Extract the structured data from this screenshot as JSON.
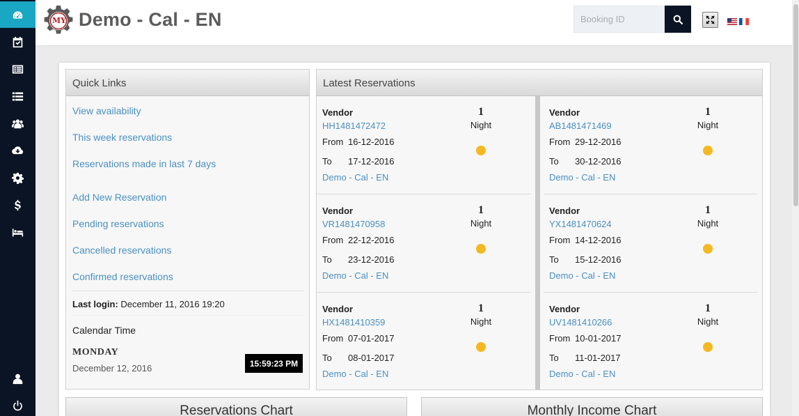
{
  "header": {
    "app_title": "Demo - Cal - EN",
    "logo_text": "MY",
    "search_placeholder": "Booking ID"
  },
  "sidebar": {
    "items": [
      {
        "icon": "dashboard-icon",
        "active": true
      },
      {
        "icon": "calendar-check-icon"
      },
      {
        "icon": "list-alt-icon"
      },
      {
        "icon": "list-icon"
      },
      {
        "icon": "users-icon"
      },
      {
        "icon": "cloud-download-icon"
      },
      {
        "icon": "gear-icon"
      },
      {
        "icon": "dollar-icon"
      },
      {
        "icon": "bed-icon"
      },
      {
        "icon": "user-icon"
      },
      {
        "icon": "power-icon"
      }
    ]
  },
  "colors": {
    "sidebar_bg": "#0b1424",
    "sidebar_active": "#1aa7c4",
    "link": "#4a90c2",
    "status_dot": "#f5b920"
  },
  "quick_links": {
    "title": "Quick Links",
    "links": [
      "View availability",
      "This week reservations",
      "Reservations made in last 7 days",
      "Add New Reservation",
      "Pending reservations",
      "Cancelled reservations",
      "Confirmed reservations"
    ],
    "last_login_label": "Last login:",
    "last_login_value": "December 11, 2016 19:20",
    "calendar_time_label": "Calendar Time",
    "day_name": "MONDAY",
    "date": "December 12, 2016",
    "clock": "15:59:23 PM"
  },
  "latest_reservations": {
    "title": "Latest Reservations",
    "vendor_label": "Vendor",
    "from_label": "From",
    "to_label": "To",
    "night_label": "Night",
    "items": [
      {
        "code": "HH1481472472",
        "from": "16-12-2016",
        "to": "17-12-2016",
        "property": "Demo - Cal - EN",
        "nights": "1"
      },
      {
        "code": "AB1481471469",
        "from": "29-12-2016",
        "to": "30-12-2016",
        "property": "Demo - Cal - EN",
        "nights": "1"
      },
      {
        "code": "VR1481470958",
        "from": "22-12-2016",
        "to": "23-12-2016",
        "property": "Demo - Cal - EN",
        "nights": "1"
      },
      {
        "code": "YX1481470624",
        "from": "14-12-2016",
        "to": "15-12-2016",
        "property": "Demo - Cal - EN",
        "nights": "1"
      },
      {
        "code": "HX1481410359",
        "from": "07-01-2017",
        "to": "08-01-2017",
        "property": "Demo - Cal - EN",
        "nights": "1"
      },
      {
        "code": "UV1481410266",
        "from": "10-01-2017",
        "to": "11-01-2017",
        "property": "Demo - Cal - EN",
        "nights": "1"
      }
    ]
  },
  "charts": {
    "reservations_title": "Reservations Chart",
    "income_title": "Monthly Income Chart"
  }
}
